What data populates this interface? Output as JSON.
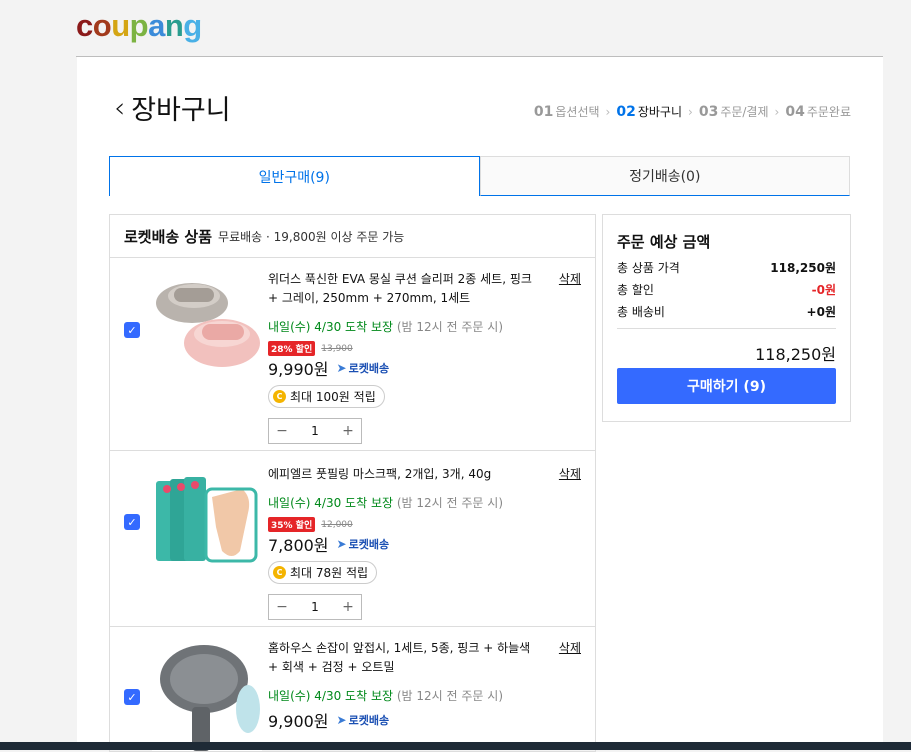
{
  "logo": {
    "letters": [
      "c",
      "o",
      "u",
      "p",
      "a",
      "n",
      "g"
    ]
  },
  "page": {
    "title": "장바구니"
  },
  "steps": [
    {
      "num": "01",
      "label": "옵션선택",
      "active": false
    },
    {
      "num": "02",
      "label": "장바구니",
      "active": true
    },
    {
      "num": "03",
      "label": "주문/결제",
      "active": false
    },
    {
      "num": "04",
      "label": "주문완료",
      "active": false
    }
  ],
  "tabs": [
    {
      "label": "일반구매(9)",
      "active": true
    },
    {
      "label": "정기배송(0)",
      "active": false
    }
  ],
  "list": {
    "header_title": "로켓배송 상품",
    "header_sub": "무료배송 · 19,800원 이상 주문 가능"
  },
  "items": [
    {
      "name": "위더스 푹신한 EVA 몽실 쿠션 슬리퍼 2종 세트, 핑크 + 그레이, 250mm + 270mm, 1세트",
      "delete": "삭제",
      "delivery": "내일(수) 4/30 도착 보장",
      "delivery_note": "(밤 12시 전 주문 시)",
      "discount": "28% 할인",
      "original_price": "13,900",
      "price": "9,990원",
      "rocket": "로켓배송",
      "cash": "최대 100원 적립",
      "qty": "1",
      "checked": true
    },
    {
      "name": "에피엘르 풋필링 마스크팩, 2개입, 3개, 40g",
      "delete": "삭제",
      "delivery": "내일(수) 4/30 도착 보장",
      "delivery_note": "(밤 12시 전 주문 시)",
      "discount": "35% 할인",
      "original_price": "12,000",
      "price": "7,800원",
      "rocket": "로켓배송",
      "cash": "최대 78원 적립",
      "qty": "1",
      "checked": true
    },
    {
      "name": "홈하우스 손잡이 앞접시, 1세트, 5종, 핑크 + 하늘색 + 회색 + 검정 + 오트밀",
      "delete": "삭제",
      "delivery": "내일(수) 4/30 도착 보장",
      "delivery_note": "(밤 12시 전 주문 시)",
      "price": "9,900원",
      "rocket": "로켓배송",
      "checked": true
    }
  ],
  "summary": {
    "title": "주문 예상 금액",
    "rows": [
      {
        "label": "총 상품 가격",
        "value": "118,250원"
      },
      {
        "label": "총 할인",
        "value": "-0원"
      },
      {
        "label": "총 배송비",
        "value": "+0원"
      }
    ],
    "total": "118,250원",
    "buy_label": "구매하기 (9)"
  },
  "colors": {
    "accent": "#346aff",
    "tab_blue": "#0073e9",
    "green": "#00891a",
    "red": "#e52528"
  }
}
